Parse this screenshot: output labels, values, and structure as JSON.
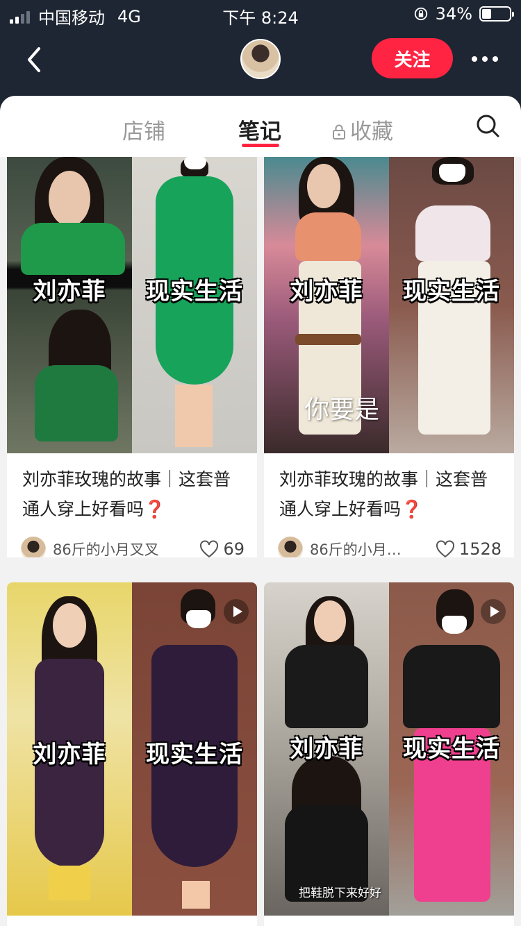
{
  "status_bar": {
    "carrier": "中国移动",
    "network": "4G",
    "time": "下午 8:24",
    "battery": "34%",
    "battery_level": 0.34
  },
  "header": {
    "follow_label": "关注"
  },
  "tabs": [
    {
      "label": "店铺",
      "active": false
    },
    {
      "label": "笔记",
      "active": true
    },
    {
      "label": "收藏",
      "active": false,
      "locked": true
    }
  ],
  "notes": [
    {
      "cover": {
        "left_text": "刘亦菲",
        "right_text": "现实生活",
        "extra_text": "",
        "is_video": false
      },
      "title": "刘亦菲玫瑰的故事｜这套普通人穿上好看吗",
      "title_mark": "❓",
      "author": "86斤的小月叉叉",
      "likes": "69"
    },
    {
      "cover": {
        "left_text": "刘亦菲",
        "right_text": "现实生活",
        "extra_text": "你要是",
        "is_video": false
      },
      "title": "刘亦菲玫瑰的故事｜这套普通人穿上好看吗",
      "title_mark": "❓",
      "author": "86斤的小月…",
      "likes": "1528"
    },
    {
      "cover": {
        "left_text": "刘亦菲",
        "right_text": "现实生活",
        "extra_text": "",
        "is_video": true
      }
    },
    {
      "cover": {
        "left_text": "刘亦菲",
        "right_text": "现实生活",
        "extra_text": "把鞋脱下来好好",
        "is_video": true
      }
    }
  ],
  "colors": {
    "header_bg": "#1e2633",
    "accent": "#ff2442",
    "page_bg": "#f2f2f2"
  },
  "icons": [
    "back-arrow-icon",
    "more-icon",
    "lock-icon",
    "search-icon",
    "heart-icon",
    "play-icon",
    "battery-icon",
    "signal-icon"
  ]
}
